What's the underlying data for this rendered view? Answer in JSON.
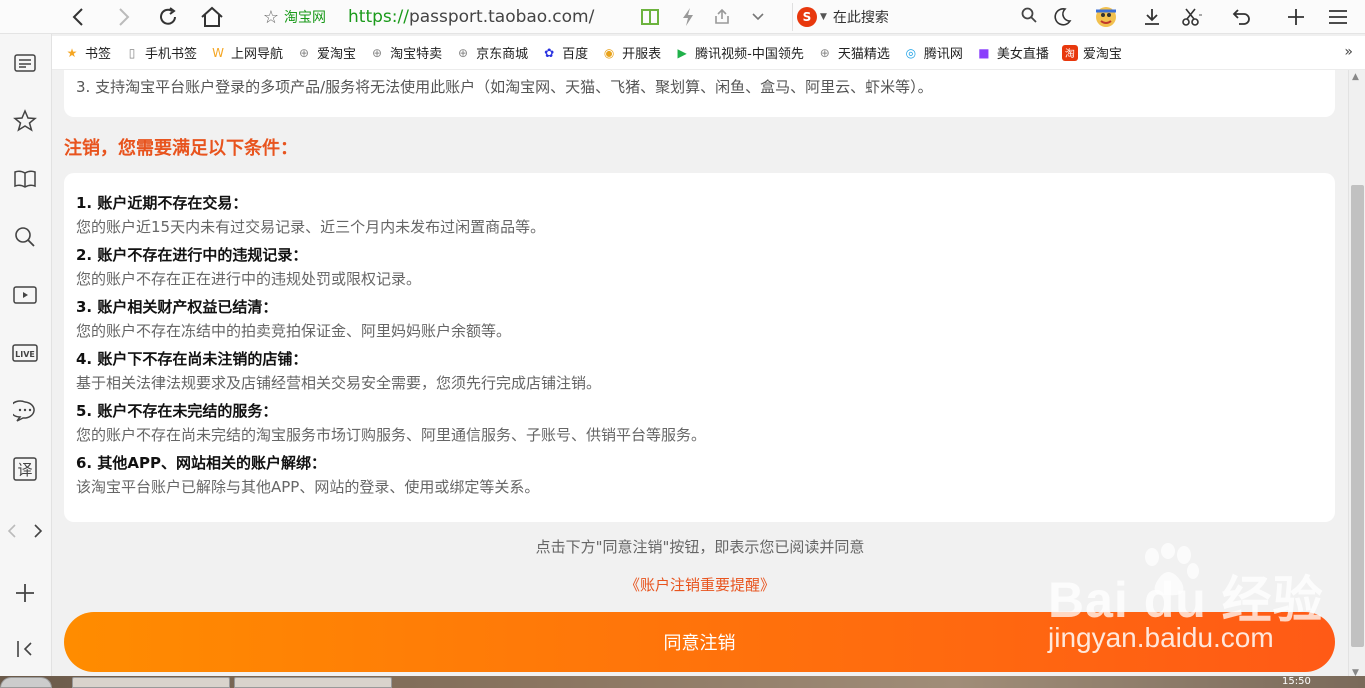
{
  "browser": {
    "site_name": "淘宝网",
    "url_prefix": "https://",
    "url_host": "passport.taobao.com/",
    "search_placeholder": "在此搜索"
  },
  "bookmarks": [
    {
      "label": "书签",
      "icon": "star-icon",
      "color": "#f5a623"
    },
    {
      "label": "手机书签",
      "icon": "phone-icon",
      "color": "#888888"
    },
    {
      "label": "上网导航",
      "icon": "w-logo-icon",
      "color": "#f5a623"
    },
    {
      "label": "爱淘宝",
      "icon": "globe-icon",
      "color": "#888888"
    },
    {
      "label": "淘宝特卖",
      "icon": "globe-icon",
      "color": "#888888"
    },
    {
      "label": "京东商城",
      "icon": "globe-icon",
      "color": "#888888"
    },
    {
      "label": "百度",
      "icon": "baidu-paw-icon",
      "color": "#2932e1"
    },
    {
      "label": "开服表",
      "icon": "game-icon",
      "color": "#e8a21b"
    },
    {
      "label": "腾讯视频-中国领先",
      "icon": "play-icon",
      "color": "#20b14a"
    },
    {
      "label": "天猫精选",
      "icon": "globe-icon",
      "color": "#888888"
    },
    {
      "label": "腾讯网",
      "icon": "qq-icon",
      "color": "#1aa0e6"
    },
    {
      "label": "美女直播",
      "icon": "video-icon",
      "color": "#8a3ffc"
    },
    {
      "label": "爱淘宝",
      "icon": "tao-icon",
      "color": "#e8380d"
    }
  ],
  "page": {
    "top_notice": "3. 支持淘宝平台账户登录的多项产品/服务将无法使用此账户（如淘宝网、天猫、飞猪、聚划算、闲鱼、盒马、阿里云、虾米等）。",
    "section_title": "注销，您需要满足以下条件：",
    "conditions": [
      {
        "title": "1. 账户近期不存在交易：",
        "desc": "您的账户近15天内未有过交易记录、近三个月内未发布过闲置商品等。"
      },
      {
        "title": "2. 账户不存在进行中的违规记录：",
        "desc": "您的账户不存在正在进行中的违规处罚或限权记录。"
      },
      {
        "title": "3. 账户相关财产权益已结清：",
        "desc": "您的账户不存在冻结中的拍卖竞拍保证金、阿里妈妈账户余额等。"
      },
      {
        "title": "4. 账户下不存在尚未注销的店铺：",
        "desc": "基于相关法律法规要求及店铺经营相关交易安全需要，您须先行完成店铺注销。"
      },
      {
        "title": "5. 账户不存在未完结的服务：",
        "desc": "您的账户不存在尚未完结的淘宝服务市场订购服务、阿里通信服务、子账号、供销平台等服务。"
      },
      {
        "title": "6. 其他APP、网站相关的账户解绑：",
        "desc": "该淘宝平台账户已解除与其他APP、网站的登录、使用或绑定等关系。"
      }
    ],
    "agree_note": "点击下方\"同意注销\"按钮，即表示您已阅读并同意",
    "agree_link": "《账户注销重要提醒》",
    "confirm_button": "同意注销"
  },
  "watermark": {
    "logo_text": "Bai  du 经验",
    "url": "jingyan.baidu.com"
  },
  "taskbar": {
    "time": "15:50"
  },
  "colors": {
    "accent": "#e8541e",
    "button_start": "#ff8c00",
    "button_end": "#ff5a16",
    "url_green": "#1a9a1a"
  }
}
